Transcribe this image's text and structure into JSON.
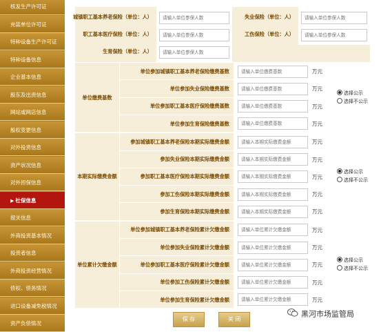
{
  "sidebar": {
    "items": [
      {
        "label": "核发生产许可证",
        "active": false
      },
      {
        "label": "充装单位许可证",
        "active": false
      },
      {
        "label": "特种设备生产许可证",
        "active": false
      },
      {
        "label": "特种设备信息",
        "active": false
      },
      {
        "label": "企业基本信息",
        "active": false
      },
      {
        "label": "股东及出资信息",
        "active": false
      },
      {
        "label": "网站或网店信息",
        "active": false
      },
      {
        "label": "股权变更信息",
        "active": false
      },
      {
        "label": "对外投资信息",
        "active": false
      },
      {
        "label": "资产状况信息",
        "active": false
      },
      {
        "label": "对外担保信息",
        "active": false
      },
      {
        "label": "社保信息",
        "active": true,
        "marker": "▶"
      },
      {
        "label": "报关信息",
        "active": false
      },
      {
        "label": "外商投资基本情况",
        "active": false
      },
      {
        "label": "投资者信息",
        "active": false
      },
      {
        "label": "外商投资经营情况",
        "active": false
      },
      {
        "label": "债权、债务情况",
        "active": false
      },
      {
        "label": "进口设备减免税情况",
        "active": false
      },
      {
        "label": "资产负债情况",
        "active": false
      }
    ]
  },
  "insured": {
    "urban_pension_label": "城镇职工基本养老保险（单位：人）",
    "unemployment_label": "失业保险（单位：人）",
    "medical_label": "职工基本医疗保险（单位：人）",
    "injury_label": "工伤保险（单位：人）",
    "maternity_label": "生育保险（单位：人）",
    "placeholder": "请输入单位参保人数"
  },
  "unit": "万元",
  "radio": {
    "show": "选择公示",
    "hide": "选择不公示"
  },
  "groups": [
    {
      "title": "单位缴费基数",
      "placeholder": "请输入单位缴费基数",
      "rows": [
        "单位参加城镇职工基本养老保险缴费基数",
        "单位参加失业保险缴费基数",
        "单位参加职工基本医疗保险缴费基数",
        "单位参加生育保险缴费基数"
      ]
    },
    {
      "title": "本期实际缴费金额",
      "placeholder": "请输入本期实际缴费金额",
      "rows": [
        "参加城镇职工基本养老保险本期实际缴费金额",
        "参加失业保险本期实际缴费金额",
        "参加职工基本医疗保险本期实际缴费金额",
        "参加工伤保险本期实际缴费金额",
        "参加生育保险本期实际缴费金额"
      ]
    },
    {
      "title": "单位累计欠缴金额",
      "placeholder": "请输入单位累计欠缴金额",
      "rows": [
        "单位参加城镇职工基本养老保险累计欠缴金额",
        "单位参加失业保险累计欠缴金额",
        "单位参加职工基本医疗保险累计欠缴金额",
        "单位参加工伤保险累计欠缴金额",
        "单位参加生育保险累计欠缴金额"
      ]
    }
  ],
  "buttons": {
    "save": "保 存",
    "close": "关 闭"
  },
  "watermark": "黑河市场监管局",
  "colors": {
    "sidebar": "#ad7f1f",
    "active": "#b2160f",
    "label_bg": "#f6eed9",
    "label_text": "#7a4a00"
  }
}
